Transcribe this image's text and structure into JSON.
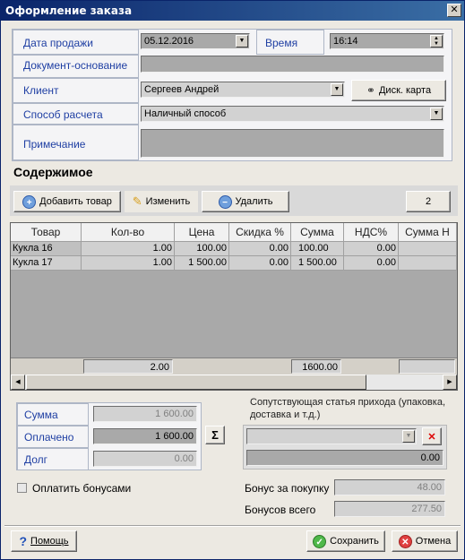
{
  "window": {
    "title": "Оформление заказа",
    "close": "✕"
  },
  "form": {
    "sale_date_label": "Дата продажи",
    "sale_date_value": "05.12.2016",
    "time_label": "Время",
    "time_value": "16:14",
    "base_doc_label": "Документ-основание",
    "base_doc_value": "",
    "client_label": "Клиент",
    "client_value": "Сергеев Андрей",
    "disc_card_label": "Диск. карта",
    "payment_label": "Способ расчета",
    "payment_value": "Наличный способ",
    "note_label": "Примечание",
    "note_value": ""
  },
  "contents": {
    "title": "Содержимое",
    "add_label": "Добавить товар",
    "edit_label": "Изменить",
    "delete_label": "Удалить",
    "count": "2"
  },
  "table": {
    "headers": [
      "Товар",
      "Кол-во",
      "Цена",
      "Скидка %",
      "Сумма",
      "НДС%",
      "Сумма Н"
    ],
    "rows": [
      [
        "Кукла 16",
        "1.00",
        "100.00",
        "0.00",
        "100.00",
        "0.00",
        ""
      ],
      [
        "Кукла 17",
        "1.00",
        "1 500.00",
        "0.00",
        "1 500.00",
        "0.00",
        ""
      ]
    ],
    "footer_qty": "2.00",
    "footer_sum": "1600.00"
  },
  "totals": {
    "sum_label": "Сумма",
    "sum_value": "1 600.00",
    "paid_label": "Оплачено",
    "paid_value": "1 600.00",
    "debt_label": "Долг",
    "debt_value": "0.00",
    "sigma": "Σ",
    "pay_bonus_label": "Оплатить бонусами",
    "related_label": "Сопутствующая статья прихода (упаковка, доставка и т.д.)",
    "related_amount": "0.00",
    "bonus_purchase_label": "Бонус за покупку",
    "bonus_purchase_value": "48.00",
    "bonus_total_label": "Бонусов всего",
    "bonus_total_value": "277.50"
  },
  "footer": {
    "help_label": "Помощь",
    "save_label": "Сохранить",
    "cancel_label": "Отмена"
  }
}
